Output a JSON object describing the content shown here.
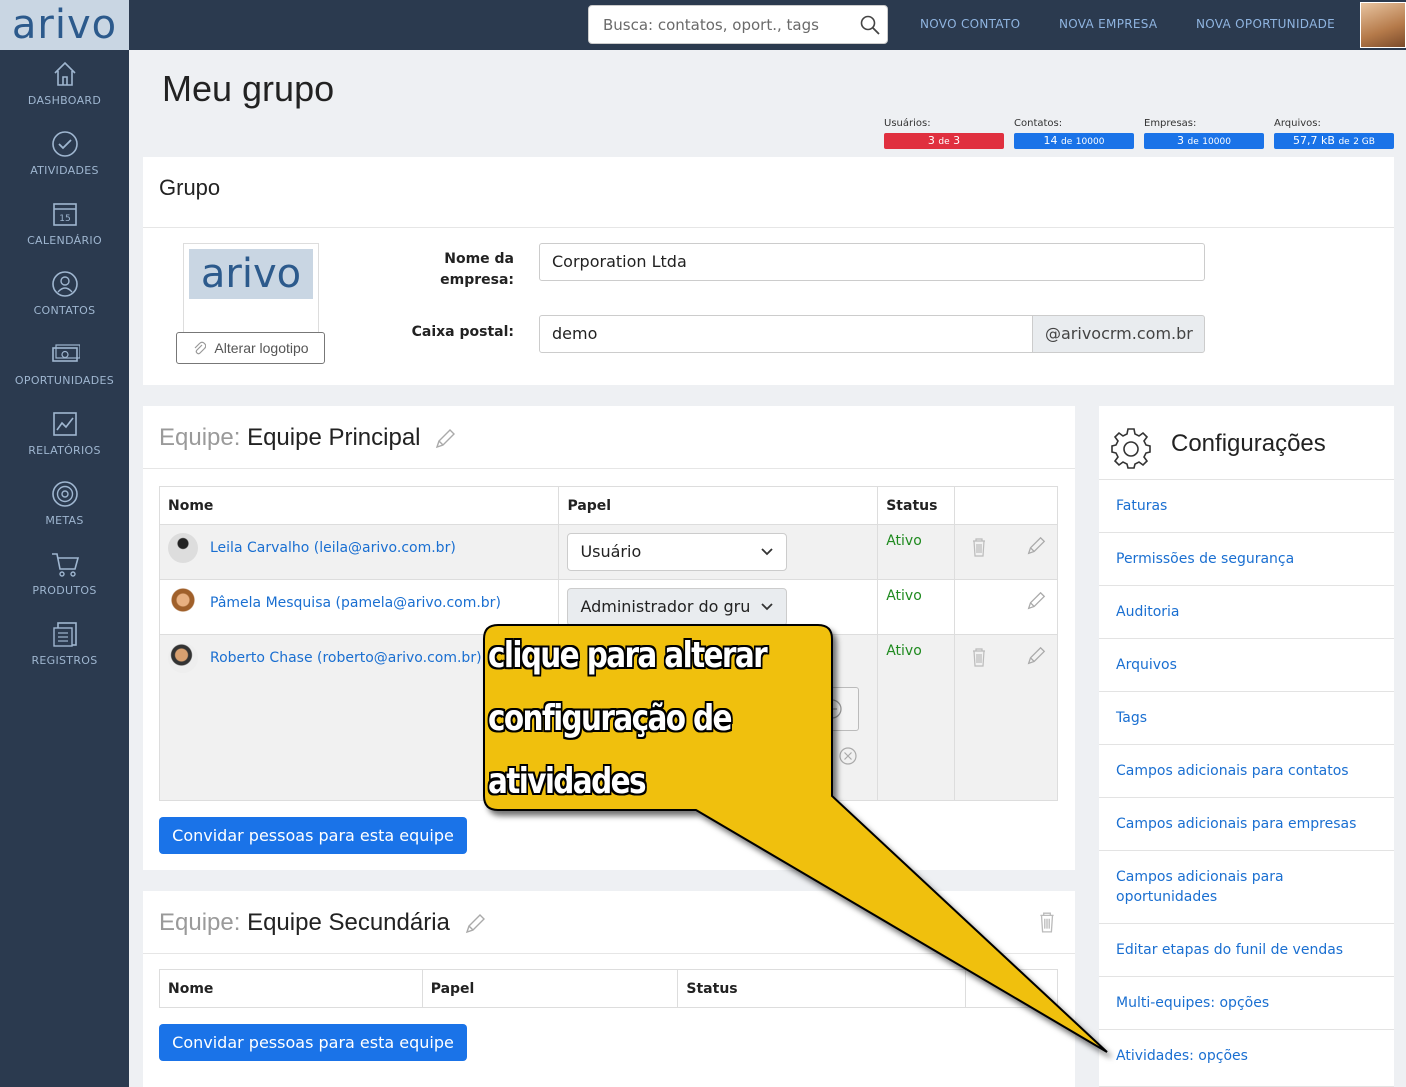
{
  "app": {
    "logo": "arivo"
  },
  "sidebar": {
    "items": [
      {
        "label": "DASHBOARD",
        "icon": "home-icon"
      },
      {
        "label": "ATIVIDADES",
        "icon": "check-circle-icon"
      },
      {
        "label": "CALENDÁRIO",
        "icon": "calendar-icon",
        "day": "15"
      },
      {
        "label": "CONTATOS",
        "icon": "contact-icon"
      },
      {
        "label": "OPORTUNIDADES",
        "icon": "money-icon"
      },
      {
        "label": "RELATÓRIOS",
        "icon": "chart-icon"
      },
      {
        "label": "METAS",
        "icon": "target-icon"
      },
      {
        "label": "PRODUTOS",
        "icon": "cart-icon"
      },
      {
        "label": "REGISTROS",
        "icon": "records-icon"
      }
    ]
  },
  "topbar": {
    "search_placeholder": "Busca: contatos, oport., tags",
    "links": [
      "NOVO CONTATO",
      "NOVA EMPRESA",
      "NOVA OPORTUNIDADE"
    ]
  },
  "page": {
    "title": "Meu grupo"
  },
  "stats": [
    {
      "label": "Usuários:",
      "value": "3",
      "sep": "de",
      "max": "3",
      "color": "#e0303f"
    },
    {
      "label": "Contatos:",
      "value": "14",
      "sep": "de",
      "max": "10000",
      "color": "#1a73e8"
    },
    {
      "label": "Empresas:",
      "value": "3",
      "sep": "de",
      "max": "10000",
      "color": "#1a73e8"
    },
    {
      "label": "Arquivos:",
      "value": "57,7 kB",
      "sep": "de",
      "max": "2 GB",
      "color": "#1a73e8"
    }
  ],
  "grupo": {
    "title": "Grupo",
    "logo_text": "arivo",
    "change_logo": "Alterar logotipo",
    "company_label": "Nome da empresa:",
    "company_value": "Corporation Ltda",
    "mailbox_label": "Caixa postal:",
    "mailbox_value": "demo",
    "mailbox_suffix": "@arivocrm.com.br"
  },
  "team1": {
    "prefix": "Equipe:",
    "name": "Equipe Principal",
    "columns": [
      "Nome",
      "Papel",
      "Status"
    ],
    "members": [
      {
        "name": "Leila Carvalho (leila@arivo.com.br)",
        "role": "Usuário",
        "status": "Ativo"
      },
      {
        "name": "Pâmela Mesquisa (pamela@arivo.com.br)",
        "role": "Administrador do gru",
        "status": "Ativo"
      },
      {
        "name": "Roberto Chase (roberto@arivo.com.br)",
        "role": "",
        "status": "Ativo"
      }
    ],
    "invite": "Convidar pessoas para esta equipe"
  },
  "team2": {
    "prefix": "Equipe:",
    "name": "Equipe Secundária",
    "columns": [
      "Nome",
      "Papel",
      "Status"
    ],
    "invite": "Convidar pessoas para esta equipe"
  },
  "config": {
    "title": "Configurações",
    "items": [
      "Faturas",
      "Permissões de segurança",
      "Auditoria",
      "Arquivos",
      "Tags",
      "Campos adicionais para contatos",
      "Campos adicionais para empresas",
      "Campos adicionais para oportunidades",
      "Editar etapas do funil de vendas",
      "Multi-equipes: opções",
      "Atividades: opções"
    ]
  },
  "callout": {
    "lines": [
      "clique para alterar",
      "configuração de",
      "atividades"
    ],
    "color": "#f0c010"
  }
}
